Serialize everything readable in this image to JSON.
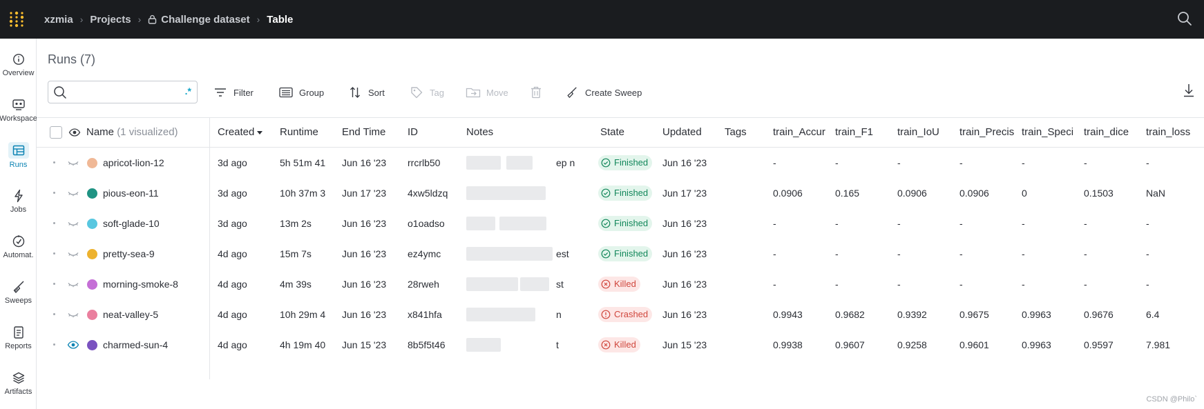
{
  "breadcrumb": {
    "entity": "xzmia",
    "projects": "Projects",
    "project": "Challenge dataset",
    "current": "Table"
  },
  "nav": [
    {
      "label": "Overview",
      "icon": "info-icon"
    },
    {
      "label": "Workspace",
      "icon": "workspace-icon"
    },
    {
      "label": "Runs",
      "icon": "table-icon",
      "active": true
    },
    {
      "label": "Jobs",
      "icon": "lightning-icon"
    },
    {
      "label": "Automat.",
      "icon": "automation-icon"
    },
    {
      "label": "Sweeps",
      "icon": "broom-icon"
    },
    {
      "label": "Reports",
      "icon": "document-icon"
    },
    {
      "label": "Artifacts",
      "icon": "layers-icon"
    }
  ],
  "header": {
    "title": "Runs (7)"
  },
  "search": {
    "placeholder": "",
    "value": "",
    "regex_label": ".*"
  },
  "toolbar": {
    "filter": "Filter",
    "group": "Group",
    "sort": "Sort",
    "tag": "Tag",
    "move": "Move",
    "create_sweep": "Create Sweep"
  },
  "table": {
    "name_header": "Name",
    "name_header_extra": "(1 visualized)",
    "columns": [
      "Created",
      "Runtime",
      "End Time",
      "ID",
      "Notes",
      "State",
      "Updated",
      "Tags",
      "train_Accur",
      "train_F1",
      "train_IoU",
      "train_Precis",
      "train_Speci",
      "train_dice",
      "train_loss"
    ],
    "rows": [
      {
        "name": "apricot-lion-12",
        "color": "#f0b896",
        "visible": false,
        "created": "3d ago",
        "runtime": "5h 51m 41",
        "end_time": "Jun 16 '23",
        "id": "rrcrlb50",
        "notes": "ep      n",
        "state": "Finished",
        "updated": "Jun 16 '23",
        "tags": "",
        "train_accur": "-",
        "train_f1": "-",
        "train_iou": "-",
        "train_precis": "-",
        "train_speci": "-",
        "train_dice": "-",
        "train_loss": "-"
      },
      {
        "name": "pious-eon-11",
        "color": "#1f9383",
        "visible": false,
        "created": "3d ago",
        "runtime": "10h 37m 3",
        "end_time": "Jun 17 '23",
        "id": "4xw5ldzq",
        "notes": "",
        "state": "Finished",
        "updated": "Jun 17 '23",
        "tags": "",
        "train_accur": "0.0906",
        "train_f1": "0.165",
        "train_iou": "0.0906",
        "train_precis": "0.0906",
        "train_speci": "0",
        "train_dice": "0.1503",
        "train_loss": "NaN"
      },
      {
        "name": "soft-glade-10",
        "color": "#58c7e0",
        "visible": false,
        "created": "3d ago",
        "runtime": "13m 2s",
        "end_time": "Jun 16 '23",
        "id": "o1oadso",
        "notes": "",
        "state": "Finished",
        "updated": "Jun 16 '23",
        "tags": "",
        "train_accur": "-",
        "train_f1": "-",
        "train_iou": "-",
        "train_precis": "-",
        "train_speci": "-",
        "train_dice": "-",
        "train_loss": "-"
      },
      {
        "name": "pretty-sea-9",
        "color": "#edb22e",
        "visible": false,
        "created": "4d ago",
        "runtime": "15m 7s",
        "end_time": "Jun 16 '23",
        "id": "ez4ymc",
        "notes": "est",
        "state": "Finished",
        "updated": "Jun 16 '23",
        "tags": "",
        "train_accur": "-",
        "train_f1": "-",
        "train_iou": "-",
        "train_precis": "-",
        "train_speci": "-",
        "train_dice": "-",
        "train_loss": "-"
      },
      {
        "name": "morning-smoke-8",
        "color": "#c56fd6",
        "visible": false,
        "created": "4d ago",
        "runtime": "4m 39s",
        "end_time": "Jun 16 '23",
        "id": "28rweh",
        "notes": "st",
        "state": "Killed",
        "updated": "Jun 16 '23",
        "tags": "",
        "train_accur": "-",
        "train_f1": "-",
        "train_iou": "-",
        "train_precis": "-",
        "train_speci": "-",
        "train_dice": "-",
        "train_loss": "-"
      },
      {
        "name": "neat-valley-5",
        "color": "#ea7f9e",
        "visible": false,
        "created": "4d ago",
        "runtime": "10h 29m 4",
        "end_time": "Jun 16 '23",
        "id": "x841hfa",
        "notes": "n",
        "state": "Crashed",
        "updated": "Jun 16 '23",
        "tags": "",
        "train_accur": "0.9943",
        "train_f1": "0.9682",
        "train_iou": "0.9392",
        "train_precis": "0.9675",
        "train_speci": "0.9963",
        "train_dice": "0.9676",
        "train_loss": "6.4"
      },
      {
        "name": "charmed-sun-4",
        "color": "#7a52c0",
        "visible": true,
        "created": "4d ago",
        "runtime": "4h 19m 40",
        "end_time": "Jun 15 '23",
        "id": "8b5f5t46",
        "notes": "t",
        "state": "Killed",
        "updated": "Jun 15 '23",
        "tags": "",
        "train_accur": "0.9938",
        "train_f1": "0.9607",
        "train_iou": "0.9258",
        "train_precis": "0.9601",
        "train_speci": "0.9963",
        "train_dice": "0.9597",
        "train_loss": "7.981"
      }
    ]
  },
  "colors": {
    "accent": "#0b83b3",
    "finished": "#12875a",
    "killed": "#d0473d",
    "topbar": "#1a1c1f"
  },
  "watermark": "CSDN @Philo`"
}
